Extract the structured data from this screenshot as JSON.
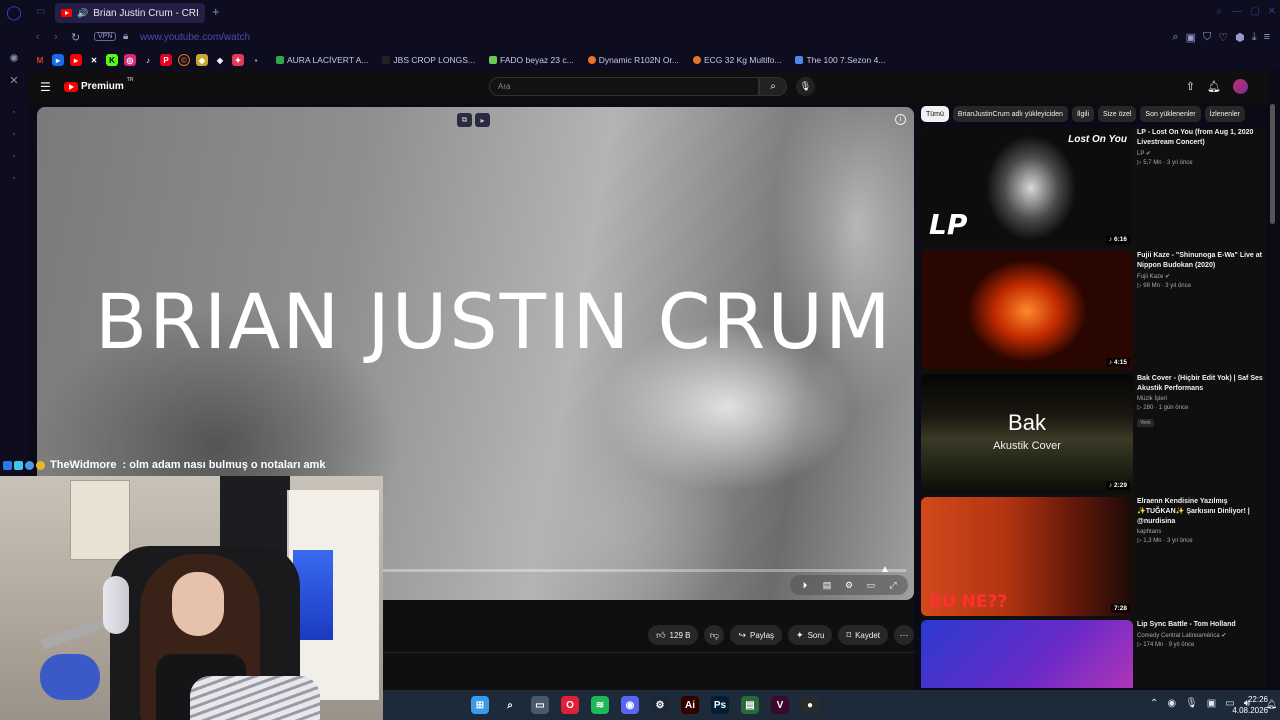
{
  "browser": {
    "tab_title": "Brian Justin Crum - CRI",
    "new_tab": "+",
    "vpn_label": "VPN",
    "url": "www.youtube.com/watch",
    "bookmarks": [
      {
        "label": "AURA LACİVERT A...",
        "color": "#2fa84a"
      },
      {
        "label": "JBS CROP LONGS...",
        "color": "#222222"
      },
      {
        "label": "FADO beyaz 23 c...",
        "color": "#6ac85a"
      },
      {
        "label": "Dynamic R102N Or...",
        "color": "#e8742a"
      },
      {
        "label": "ECG 32 Kg Multifo...",
        "color": "#e8742a"
      },
      {
        "label": "The 100 7.Sezon 4...",
        "color": "#4a8ae8"
      }
    ]
  },
  "youtube": {
    "logo": "Premium",
    "logo_sup": "TR",
    "search_placeholder": "Ara",
    "video_title_text": "BRIAN JUSTIN CRUM",
    "actions": {
      "likes": "129 B",
      "share": "Paylaş",
      "ask": "Soru",
      "save": "Kaydet"
    },
    "chips": [
      "Tümü",
      "BrianJustinCrum adlı yükleyiciden",
      "İlgili",
      "Size özel",
      "Son yüklenenler",
      "İzlenenler"
    ],
    "recommendations": [
      {
        "title": "LP - Lost On You (from Aug 1, 2020 Livestream Concert)",
        "channel": "LP ✔",
        "stats": "▷ 5,7 Mn · 3 yıl önce",
        "duration": "♪ 6:16",
        "thumb_text": "Lost On You",
        "thumb_logo": "LP"
      },
      {
        "title": "Fujii Kaze - \"Shinunoga E-Wa\" Live at Nippon Budokan (2020)",
        "channel": "Fujii Kaze ✔",
        "stats": "▷ 98 Mn · 3 yıl önce",
        "duration": "♪ 4:15"
      },
      {
        "title": "Bak Cover - (Hiçbir Edit Yok) | Saf Ses Akustik Performans",
        "channel": "Müzik İşleri",
        "stats": "▷ 280 · 1 gün önce",
        "badge": "Yeni",
        "duration": "♪ 2:29",
        "thumb_text": "Bak",
        "thumb_sub": "Akustik Cover"
      },
      {
        "title": "Elraenn Kendisine Yazılmış ✨TUĞKAN✨ Şarkısını Dinliyor! | @nurdisina",
        "channel": "kaphtans",
        "stats": "▷ 1,3 Mn · 3 yıl önce",
        "duration": "7:28",
        "thumb_text": "BU NE??"
      },
      {
        "title": "Lip Sync Battle - Tom Holland",
        "channel": "Comedy Central Latinoamérica ✔",
        "stats": "▷ 174 Mn · 9 yıl önce",
        "duration": ""
      }
    ]
  },
  "stream": {
    "chat_user": "TheWidmore",
    "chat_message": ": olm adam nası bulmuş o notaları amk"
  },
  "taskbar": {
    "time": "22:26",
    "date": "4.08.2026",
    "apps": [
      {
        "name": "windows",
        "color": "#3a9ae8",
        "glyph": "⊞"
      },
      {
        "name": "search",
        "color": "transparent",
        "glyph": "⌕"
      },
      {
        "name": "news",
        "color": "#4a5a6a",
        "glyph": "▭"
      },
      {
        "name": "opera",
        "color": "#e0203a",
        "glyph": "O"
      },
      {
        "name": "spotify",
        "color": "#1db954",
        "glyph": "≋"
      },
      {
        "name": "discord",
        "color": "#5865f2",
        "glyph": "◉"
      },
      {
        "name": "steam",
        "color": "#1b2838",
        "glyph": "⚙"
      },
      {
        "name": "illustrator",
        "color": "#330000",
        "glyph": "Ai"
      },
      {
        "name": "photoshop",
        "color": "#001e36",
        "glyph": "Ps"
      },
      {
        "name": "files",
        "color": "#2a6a3a",
        "glyph": "▤"
      },
      {
        "name": "app",
        "color": "#3a0a2a",
        "glyph": "V"
      },
      {
        "name": "obs",
        "color": "#2a2a2a",
        "glyph": "●"
      }
    ]
  }
}
